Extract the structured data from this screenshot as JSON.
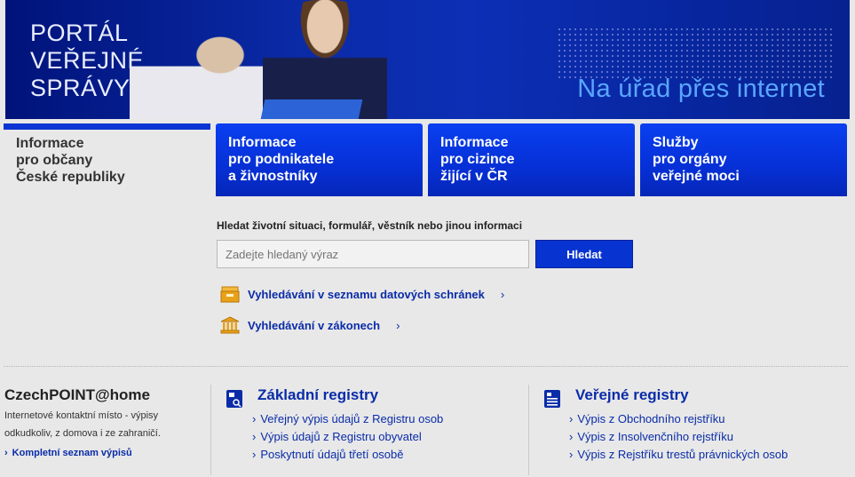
{
  "banner": {
    "logo_lines": [
      "PORTÁL",
      "VEŘEJNÉ",
      "SPRÁVY"
    ],
    "slogan": "Na úřad přes internet"
  },
  "tabs": [
    {
      "lines": [
        "Informace",
        "pro občany",
        "České republiky"
      ],
      "active": true
    },
    {
      "lines": [
        "Informace",
        "pro podnikatele",
        "a živnostníky"
      ],
      "active": false
    },
    {
      "lines": [
        "Informace",
        "pro cizince",
        "žijící v ČR"
      ],
      "active": false
    },
    {
      "lines": [
        "Služby",
        "pro orgány",
        "veřejné moci"
      ],
      "active": false
    }
  ],
  "search": {
    "label": "Hledat životní situaci, formulář, věstník nebo jinou informaci",
    "placeholder": "Zadejte hledaný výraz",
    "button": "Hledat"
  },
  "quick_links": [
    {
      "label": "Vyhledávání v seznamu datových schránek",
      "chevron": "›",
      "icon": "mailbox-icon"
    },
    {
      "label": "Vyhledávání v zákonech",
      "chevron": "›",
      "icon": "building-icon"
    }
  ],
  "czechpoint": {
    "title": "CzechPOINT@home",
    "description": "Internetové kontaktní místo - výpisy odkudkoliv, z domova i ze zahraničí.",
    "link": "Kompletní seznam výpisů",
    "chevron": "›"
  },
  "basic_registers": {
    "title": "Základní registry",
    "icon": "registry-document-icon",
    "items": [
      "Veřejný výpis údajů z Registru osob",
      "Výpis údajů z Registru obyvatel",
      "Poskytnutí údajů třetí osobě"
    ]
  },
  "public_registers": {
    "title": "Veřejné registry",
    "icon": "list-document-icon",
    "items": [
      "Výpis z Obchodního rejstříku",
      "Výpis z Insolvenčního rejstříku",
      "Výpis z Rejstříku trestů právnických osob"
    ]
  },
  "colors": {
    "brand_blue": "#0733d0",
    "link_blue": "#0a2ca8",
    "slogan_blue": "#5aa6ff",
    "icon_orange": "#e8a21a"
  }
}
